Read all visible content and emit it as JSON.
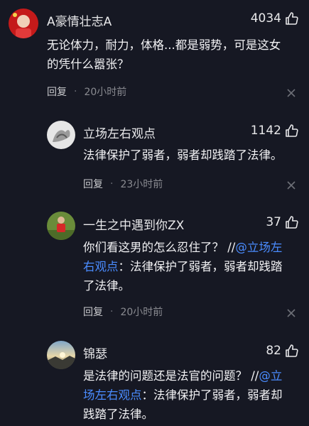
{
  "comments": [
    {
      "username": "A豪情壮志A",
      "likes": "4034",
      "text_lines": [
        "无论体力，耐力，体格...都是弱势，可是这女",
        "的凭什么嚣张？"
      ],
      "reply_label": "回复",
      "dot": "·",
      "time": "20小时前"
    },
    {
      "username": "立场左右观点",
      "likes": "1142",
      "text_lines": [
        "法律保护了弱者，弱者却践踏了法律。"
      ],
      "reply_label": "回复",
      "dot": "·",
      "time": "23小时前"
    },
    {
      "username": "一生之中遇到你ZX",
      "likes": "37",
      "text_line1_plain": "你们看这男的怎么忍住了？ //",
      "text_line1_mention": "@立场左",
      "text_line2_mention": "右观点",
      "text_line2_plain": "：法律保护了弱者，弱者却践踏",
      "text_line3_plain": "了法律。",
      "reply_label": "回复",
      "dot": "·",
      "time": "20小时前"
    },
    {
      "username": "锦瑟",
      "likes": "82",
      "text_line1_plain": "是法律的问题还是法官的问题？ //",
      "text_line1_mention": "@立",
      "text_line2_mention": "场左右观点",
      "text_line2_plain": "：法律保护了弱者，弱者却",
      "text_line3_plain": "践踏了法律。"
    }
  ],
  "colors": {
    "background": "#161823",
    "mention": "#4a8cff",
    "text": "#f2f2f4",
    "muted": "#8a8b91"
  },
  "icons": {
    "like": "thumbs-up-icon",
    "close": "close-icon"
  }
}
